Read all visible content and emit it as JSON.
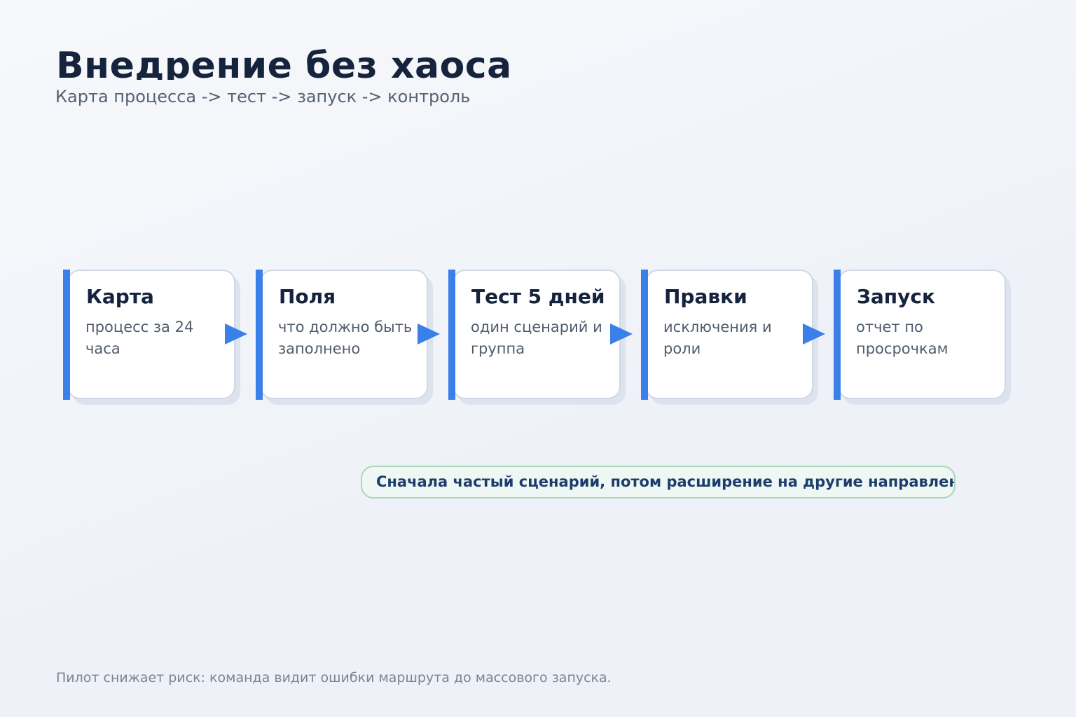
{
  "title": "Внедрение без хаоса",
  "subtitle": "Карта процесса -> тест -> запуск -> контроль",
  "steps": [
    {
      "title": "Карта",
      "desc": "процесс за 24 часа"
    },
    {
      "title": "Поля",
      "desc": "что должно быть заполнено"
    },
    {
      "title": "Тест 5 дней",
      "desc": "один сценарий и группа"
    },
    {
      "title": "Правки",
      "desc": "исключения и роли"
    },
    {
      "title": "Запуск",
      "desc": "отчет по просрочкам"
    }
  ],
  "note": "Сначала частый сценарий, потом расширение на другие направления",
  "footer": "Пилот снижает риск: команда видит ошибки маршрута до массового запуска.",
  "colors": {
    "accent": "#3a80e8",
    "title": "#15233d",
    "note_border": "#a7d8b6",
    "note_text": "#1c3d6b"
  }
}
